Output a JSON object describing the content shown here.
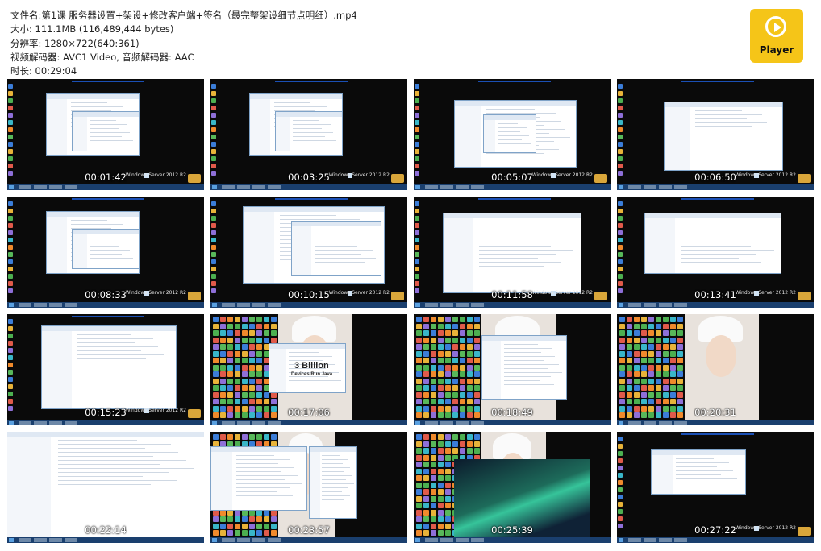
{
  "info": {
    "filename": "文件名:第1课 服务器设置+架设+修改客户端+签名（最完整架设细节点明细）.mp4",
    "size": "大小: 111.1MB (116,489,444 bytes)",
    "resolution": "分辨率: 1280×722(640:361)",
    "codec": "视频解码器: AVC1 Video, 音频解码器: AAC",
    "duration": "时长: 00:29:04"
  },
  "player": {
    "label": "Player"
  },
  "watermark": "Windows Server 2012 R2",
  "thumbnails": [
    {
      "time": "00:01:42",
      "kind": "explorer"
    },
    {
      "time": "00:03:25",
      "kind": "explorer"
    },
    {
      "time": "00:05:07",
      "kind": "installer"
    },
    {
      "time": "00:06:50",
      "kind": "explorer-wide"
    },
    {
      "time": "00:08:33",
      "kind": "explorer"
    },
    {
      "time": "00:10:15",
      "kind": "dialogs"
    },
    {
      "time": "00:11:58",
      "kind": "editor"
    },
    {
      "time": "00:13:41",
      "kind": "explorer-list"
    },
    {
      "time": "00:15:23",
      "kind": "explorer-blue"
    },
    {
      "time": "00:17:06",
      "kind": "desktop-java"
    },
    {
      "time": "00:18:49",
      "kind": "desktop-explorer"
    },
    {
      "time": "00:20:31",
      "kind": "desktop-photo"
    },
    {
      "time": "00:22:14",
      "kind": "code"
    },
    {
      "time": "00:23:57",
      "kind": "desktop-dialog"
    },
    {
      "time": "00:25:39",
      "kind": "emulator"
    },
    {
      "time": "00:27:22",
      "kind": "explorer-small"
    }
  ],
  "java_banner": {
    "line1": "3 Billion",
    "line2": "Devices Run Java"
  },
  "colors": {
    "player_bg": "#f5c518",
    "taskbar": "#1a3f6e",
    "desktop": "#0a0a0a"
  }
}
